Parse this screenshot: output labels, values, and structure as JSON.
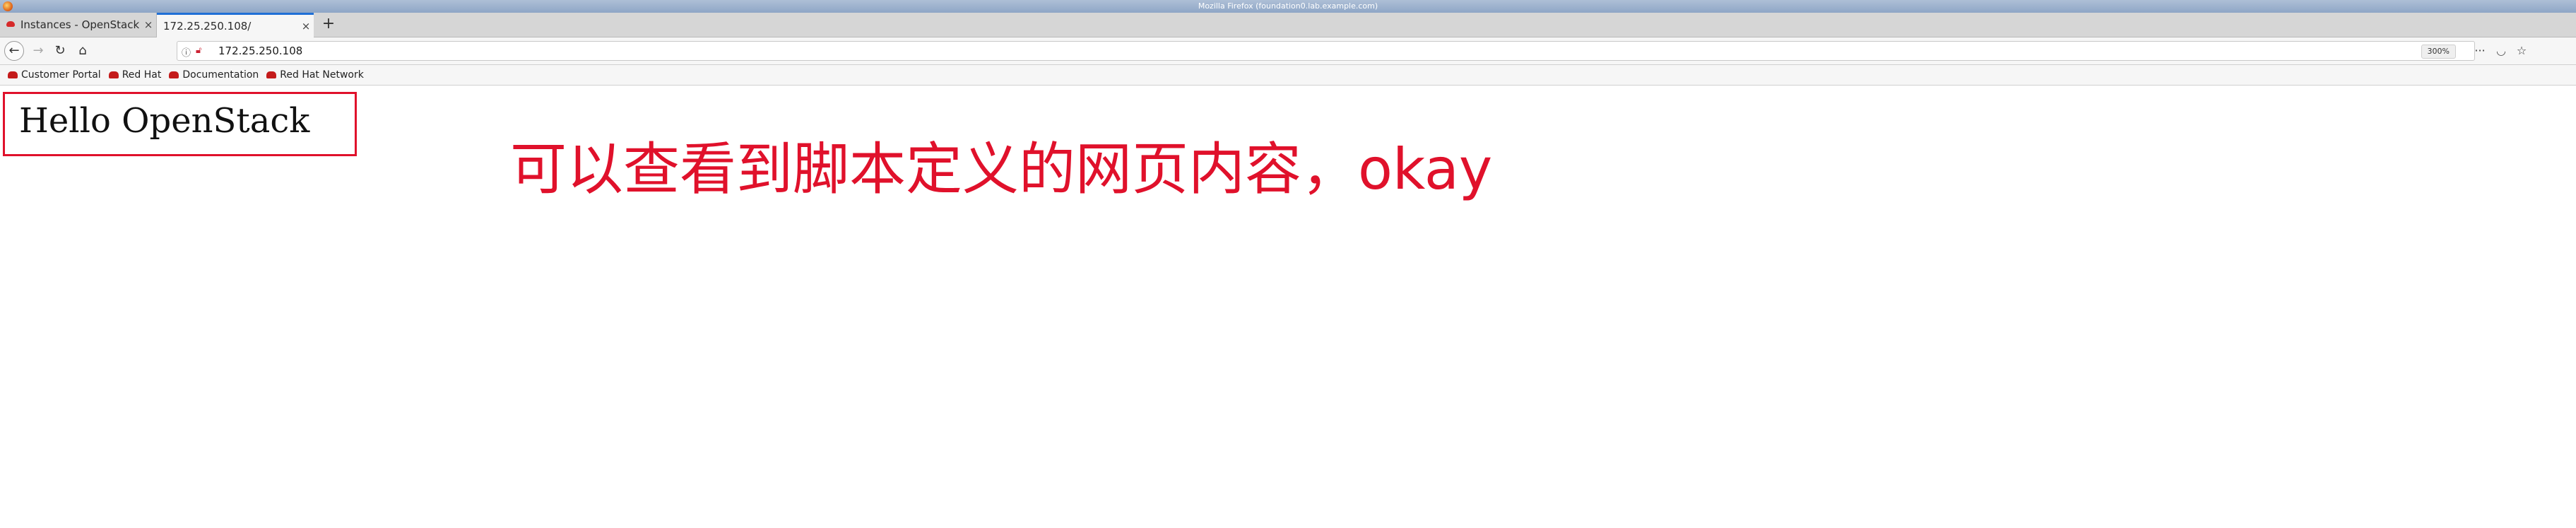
{
  "window": {
    "title": "Mozilla Firefox (foundation0.lab.example.com)"
  },
  "tabs": [
    {
      "label": "Instances - OpenStack Dashboard",
      "active": false,
      "close": "×"
    },
    {
      "label": "172.25.250.108/",
      "active": true,
      "close": "×"
    }
  ],
  "toolbar": {
    "url": "172.25.250.108",
    "zoom": "300%",
    "icons": {
      "back": "arrow-left-icon",
      "forward": "arrow-right-icon",
      "reload": "reload-icon",
      "home": "home-icon",
      "more": "more-icon",
      "pocket": "pocket-icon",
      "star": "star-icon"
    }
  },
  "bookmarks": [
    {
      "label": "Customer Portal"
    },
    {
      "label": "Red Hat"
    },
    {
      "label": "Documentation"
    },
    {
      "label": "Red Hat Network"
    }
  ],
  "page": {
    "heading": "Hello OpenStack",
    "annotation": "可以查看到脚本定义的网页内容，okay"
  },
  "colors": {
    "accent": "#e0112b",
    "tab_indicator": "#1f6fd6"
  }
}
